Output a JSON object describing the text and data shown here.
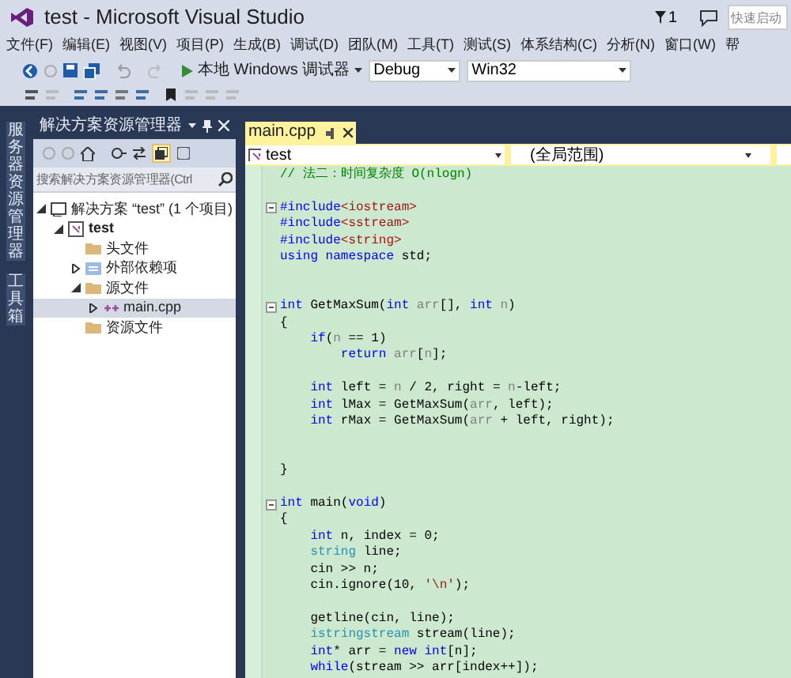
{
  "window": {
    "title": "test - Microsoft Visual Studio",
    "notification_count": "1",
    "quick_launch": {
      "placeholder": "快速启动"
    }
  },
  "menu": [
    "文件(F)",
    "编辑(E)",
    "视图(V)",
    "项目(P)",
    "生成(B)",
    "调试(D)",
    "团队(M)",
    "工具(T)",
    "测试(S)",
    "体系结构(C)",
    "分析(N)",
    "窗口(W)",
    "帮"
  ],
  "toolbar": {
    "run_button": "本地 Windows 调试器",
    "configuration": "Debug",
    "platform": "Win32"
  },
  "side_tabs": [
    "服务器资源管理器",
    "工具箱"
  ],
  "solution_explorer": {
    "title": "解决方案资源管理器",
    "search": {
      "placeholder": "搜索解决方案资源管理器(Ctrl"
    },
    "tree": [
      {
        "label": "解决方案 “test” (1 个项目)",
        "kind": "solution",
        "expanded": true,
        "selected": false,
        "children": [
          {
            "label": "test",
            "kind": "project",
            "expanded": true,
            "selected": false,
            "children": [
              {
                "label": "头文件",
                "kind": "folder",
                "selected": false
              },
              {
                "label": "外部依赖项",
                "kind": "deps",
                "expanded": false,
                "selected": false
              },
              {
                "label": "源文件",
                "kind": "folder",
                "expanded": true,
                "selected": false,
                "children": [
                  {
                    "label": "main.cpp",
                    "kind": "cpp",
                    "expanded": false,
                    "selected": true
                  }
                ]
              },
              {
                "label": "资源文件",
                "kind": "folder",
                "selected": false
              }
            ]
          }
        ]
      }
    ]
  },
  "editor": {
    "tab": "main.cpp",
    "project_dropdown": "test",
    "scope_dropdown": "(全局范围)",
    "lines": [
      {
        "kind": "code",
        "fold": false,
        "tokens": [
          {
            "kind": "cm",
            "text": "// 法二：时间复杂度 O(nlogn)"
          }
        ]
      },
      {
        "kind": "blank"
      },
      {
        "kind": "code",
        "fold": true,
        "tokens": [
          {
            "kind": "kw",
            "text": "#include"
          },
          {
            "kind": "str",
            "text": "<iostream>"
          }
        ]
      },
      {
        "kind": "code",
        "fold": false,
        "tokens": [
          {
            "kind": "kw",
            "text": "#include"
          },
          {
            "kind": "str",
            "text": "<sstream>"
          }
        ]
      },
      {
        "kind": "code",
        "fold": false,
        "tokens": [
          {
            "kind": "kw",
            "text": "#include"
          },
          {
            "kind": "str",
            "text": "<string>"
          }
        ]
      },
      {
        "kind": "code",
        "fold": false,
        "tokens": [
          {
            "kind": "kw",
            "text": "using namespace"
          },
          {
            "kind": "pl",
            "text": " std;"
          }
        ]
      },
      {
        "kind": "blank"
      },
      {
        "kind": "blank"
      },
      {
        "kind": "code",
        "fold": true,
        "tokens": [
          {
            "kind": "kw",
            "text": "int"
          },
          {
            "kind": "pl",
            "text": " GetMaxSum("
          },
          {
            "kind": "kw",
            "text": "int"
          },
          {
            "kind": "par",
            "text": " arr"
          },
          {
            "kind": "pl",
            "text": "[], "
          },
          {
            "kind": "kw",
            "text": "int"
          },
          {
            "kind": "par",
            "text": " n"
          },
          {
            "kind": "pl",
            "text": ")"
          }
        ]
      },
      {
        "kind": "code",
        "fold": false,
        "tokens": [
          {
            "kind": "pl",
            "text": "{"
          }
        ]
      },
      {
        "kind": "code",
        "fold": false,
        "tokens": [
          {
            "kind": "kw",
            "text": "    if"
          },
          {
            "kind": "pl",
            "text": "("
          },
          {
            "kind": "par",
            "text": "n"
          },
          {
            "kind": "pl",
            "text": " == 1)"
          }
        ]
      },
      {
        "kind": "code",
        "fold": false,
        "tokens": [
          {
            "kind": "kw",
            "text": "        return"
          },
          {
            "kind": "par",
            "text": " arr"
          },
          {
            "kind": "pl",
            "text": "["
          },
          {
            "kind": "par",
            "text": "n"
          },
          {
            "kind": "pl",
            "text": "];"
          }
        ]
      },
      {
        "kind": "blank"
      },
      {
        "kind": "code",
        "fold": false,
        "tokens": [
          {
            "kind": "kw",
            "text": "    int"
          },
          {
            "kind": "pl",
            "text": " left = "
          },
          {
            "kind": "par",
            "text": "n"
          },
          {
            "kind": "pl",
            "text": " / 2, right = "
          },
          {
            "kind": "par",
            "text": "n"
          },
          {
            "kind": "pl",
            "text": "-left;"
          }
        ]
      },
      {
        "kind": "code",
        "fold": false,
        "tokens": [
          {
            "kind": "kw",
            "text": "    int"
          },
          {
            "kind": "pl",
            "text": " lMax = GetMaxSum("
          },
          {
            "kind": "par",
            "text": "arr"
          },
          {
            "kind": "pl",
            "text": ", left);"
          }
        ]
      },
      {
        "kind": "code",
        "fold": false,
        "tokens": [
          {
            "kind": "kw",
            "text": "    int"
          },
          {
            "kind": "pl",
            "text": " rMax = GetMaxSum("
          },
          {
            "kind": "par",
            "text": "arr"
          },
          {
            "kind": "pl",
            "text": " + left, right);"
          }
        ]
      },
      {
        "kind": "blank"
      },
      {
        "kind": "blank"
      },
      {
        "kind": "code",
        "fold": false,
        "tokens": [
          {
            "kind": "pl",
            "text": "}"
          }
        ]
      },
      {
        "kind": "blank"
      },
      {
        "kind": "code",
        "fold": true,
        "tokens": [
          {
            "kind": "kw",
            "text": "int"
          },
          {
            "kind": "pl",
            "text": " main("
          },
          {
            "kind": "kw",
            "text": "void"
          },
          {
            "kind": "pl",
            "text": ")"
          }
        ]
      },
      {
        "kind": "code",
        "fold": false,
        "tokens": [
          {
            "kind": "pl",
            "text": "{"
          }
        ]
      },
      {
        "kind": "code",
        "fold": false,
        "tokens": [
          {
            "kind": "kw",
            "text": "    int"
          },
          {
            "kind": "pl",
            "text": " n, index = 0;"
          }
        ]
      },
      {
        "kind": "code",
        "fold": false,
        "tokens": [
          {
            "kind": "type",
            "text": "    string"
          },
          {
            "kind": "pl",
            "text": " line;"
          }
        ]
      },
      {
        "kind": "code",
        "fold": false,
        "tokens": [
          {
            "kind": "pl",
            "text": "    cin >> n;"
          }
        ]
      },
      {
        "kind": "code",
        "fold": false,
        "tokens": [
          {
            "kind": "pl",
            "text": "    cin.ignore(10, "
          },
          {
            "kind": "str",
            "text": "'\\n'"
          },
          {
            "kind": "pl",
            "text": ");"
          }
        ]
      },
      {
        "kind": "blank"
      },
      {
        "kind": "code",
        "fold": false,
        "tokens": [
          {
            "kind": "pl",
            "text": "    getline(cin, line);"
          }
        ]
      },
      {
        "kind": "code",
        "fold": false,
        "tokens": [
          {
            "kind": "type",
            "text": "    istringstream"
          },
          {
            "kind": "pl",
            "text": " stream(line);"
          }
        ]
      },
      {
        "kind": "code",
        "fold": false,
        "tokens": [
          {
            "kind": "kw",
            "text": "    int"
          },
          {
            "kind": "pl",
            "text": "* arr = "
          },
          {
            "kind": "kw",
            "text": "new int"
          },
          {
            "kind": "pl",
            "text": "[n];"
          }
        ]
      },
      {
        "kind": "code",
        "fold": false,
        "tokens": [
          {
            "kind": "kw",
            "text": "    while"
          },
          {
            "kind": "pl",
            "text": "(stream >> arr[index++]);"
          }
        ]
      }
    ]
  }
}
